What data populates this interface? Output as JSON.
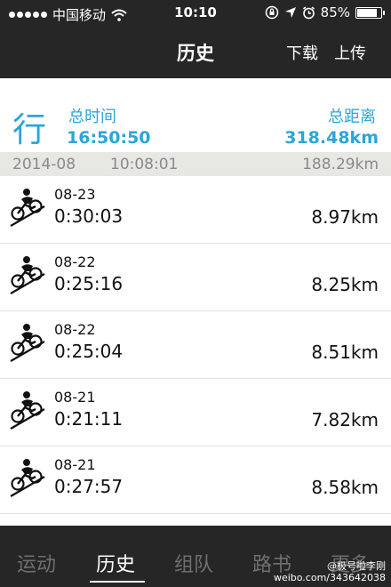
{
  "status_bar": {
    "carrier": "中国移动",
    "time": "10:10",
    "battery": "85%",
    "battery_level": 0.85,
    "icons": [
      "signal-dots",
      "wifi-icon",
      "lock-rotation-icon",
      "location-arrow-icon",
      "alarm-icon",
      "battery-icon"
    ]
  },
  "nav": {
    "title": "历史",
    "download": "下载",
    "upload": "上传"
  },
  "summary": {
    "glyph": "行",
    "total_time_label": "总时间",
    "total_time": "16:50:50",
    "total_distance_label": "总距离",
    "total_distance": "318.48km",
    "accent": "#2aa6d8"
  },
  "month": {
    "label": "2014-08",
    "duration": "10:08:01",
    "distance": "188.29km"
  },
  "rides": [
    {
      "date": "08-23",
      "duration": "0:30:03",
      "distance": "8.97km",
      "icon": "cycling-icon"
    },
    {
      "date": "08-22",
      "duration": "0:25:16",
      "distance": "8.25km",
      "icon": "cycling-icon"
    },
    {
      "date": "08-22",
      "duration": "0:25:04",
      "distance": "8.51km",
      "icon": "cycling-icon"
    },
    {
      "date": "08-21",
      "duration": "0:21:11",
      "distance": "7.82km",
      "icon": "cycling-icon"
    },
    {
      "date": "08-21",
      "duration": "0:27:57",
      "distance": "8.58km",
      "icon": "cycling-icon"
    }
  ],
  "tabs": [
    {
      "label": "运动",
      "active": false
    },
    {
      "label": "历史",
      "active": true
    },
    {
      "label": "组队",
      "active": false
    },
    {
      "label": "路书",
      "active": false
    },
    {
      "label": "更多",
      "active": false
    }
  ],
  "watermark": {
    "line1": "@极号啦李刚",
    "line2": "weibo.com/343642038"
  }
}
